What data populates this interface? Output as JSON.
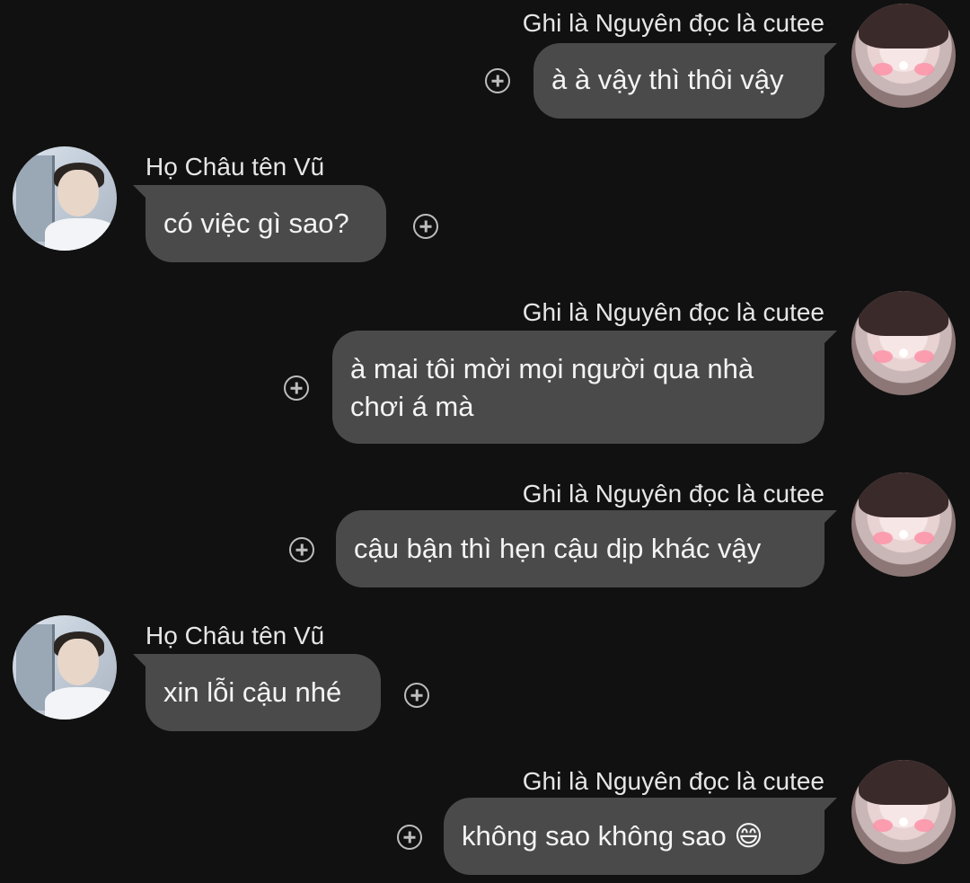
{
  "conversation": {
    "messages": [
      {
        "side": "right",
        "sender": "Ghi là Nguyên đọc là cutee",
        "lines": [
          "à à vậy thì thôi vậy"
        ]
      },
      {
        "side": "left",
        "sender": "Họ Châu tên Vũ",
        "lines": [
          "có việc gì sao?"
        ]
      },
      {
        "side": "right",
        "sender": "Ghi là Nguyên đọc là cutee",
        "lines": [
          "à mai tôi mời mọi người qua nhà",
          "chơi á mà"
        ]
      },
      {
        "side": "right",
        "sender": "Ghi là Nguyên đọc là cutee",
        "lines": [
          "cậu bận thì hẹn cậu dịp khác vậy"
        ]
      },
      {
        "side": "left",
        "sender": "Họ Châu tên Vũ",
        "lines": [
          "xin lỗi cậu nhé"
        ]
      },
      {
        "side": "right",
        "sender": "Ghi là Nguyên đọc là cutee",
        "lines": [
          "không sao không sao 😄"
        ]
      }
    ]
  },
  "icons": {
    "add_reaction": "plus-circle-icon",
    "avatar_self": "avatar",
    "avatar_other": "avatar"
  },
  "colors": {
    "background": "#111111",
    "bubble": "#4a4a4a",
    "text": "#f4f4f4",
    "icon": "#bdbdbd"
  }
}
